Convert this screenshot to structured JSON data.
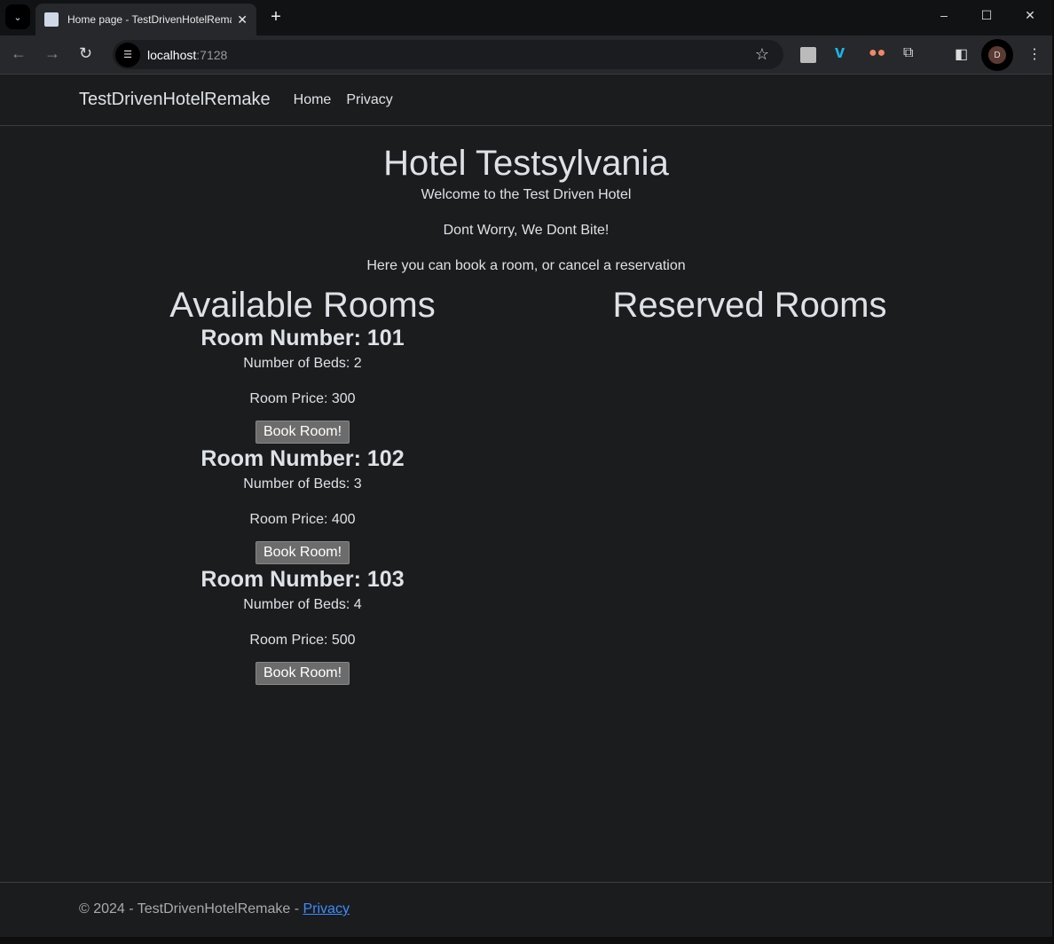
{
  "browser": {
    "tab_title": "Home page - TestDrivenHotelRemake",
    "url_host": "localhost",
    "url_port": ":7128",
    "profile_initial": "D"
  },
  "nav": {
    "brand": "TestDrivenHotelRemake",
    "links": [
      "Home",
      "Privacy"
    ]
  },
  "main": {
    "title": "Hotel Testsylvania",
    "intro": [
      "Welcome to the Test Driven Hotel",
      "Dont Worry, We Dont Bite!",
      "Here you can book a room, or cancel a reservation"
    ],
    "available_heading": "Available Rooms",
    "reserved_heading": "Reserved Rooms",
    "rooms": [
      {
        "number": "Room Number: 101",
        "beds": "Number of Beds: 2",
        "price": "Room Price: 300",
        "button": "Book Room!"
      },
      {
        "number": "Room Number: 102",
        "beds": "Number of Beds: 3",
        "price": "Room Price: 400",
        "button": "Book Room!"
      },
      {
        "number": "Room Number: 103",
        "beds": "Number of Beds: 4",
        "price": "Room Price: 500",
        "button": "Book Room!"
      }
    ]
  },
  "footer": {
    "text": "© 2024 - TestDrivenHotelRemake - ",
    "link": "Privacy"
  }
}
